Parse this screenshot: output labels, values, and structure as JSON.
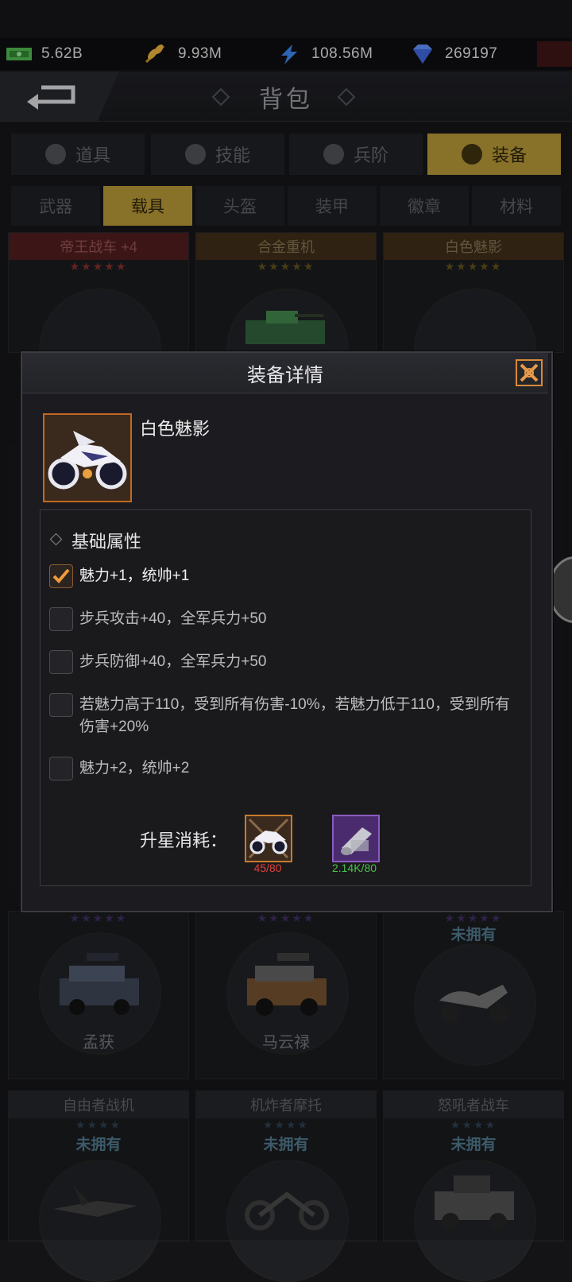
{
  "resources": [
    {
      "icon": "cash-icon",
      "value": "5.62B"
    },
    {
      "icon": "wheat-icon",
      "value": "9.93M"
    },
    {
      "icon": "lightning-icon",
      "value": "108.56M"
    },
    {
      "icon": "diamond-icon",
      "value": "269197"
    }
  ],
  "header": {
    "title": "背包"
  },
  "main_tabs": [
    {
      "label": "道具",
      "active": false
    },
    {
      "label": "技能",
      "active": false
    },
    {
      "label": "兵阶",
      "active": false
    },
    {
      "label": "装备",
      "active": true
    }
  ],
  "sub_tabs": [
    {
      "label": "武器",
      "active": false
    },
    {
      "label": "载具",
      "active": true
    },
    {
      "label": "头盔",
      "active": false
    },
    {
      "label": "装甲",
      "active": false
    },
    {
      "label": "徽章",
      "active": false
    },
    {
      "label": "材料",
      "active": false
    }
  ],
  "cards_top": [
    {
      "name": "帝王战车 +4",
      "stars": 3,
      "max_stars": 5
    },
    {
      "name": "合金重机",
      "stars": 1,
      "max_stars": 5
    },
    {
      "name": "白色魅影",
      "stars": 1,
      "max_stars": 5
    }
  ],
  "cards_mid": [
    {
      "owner": "孟获",
      "status": ""
    },
    {
      "owner": "马云禄",
      "status": ""
    },
    {
      "owner": "",
      "status": "未拥有"
    }
  ],
  "cards_bottom": [
    {
      "name": "自由者战机",
      "status": "未拥有"
    },
    {
      "name": "机炸者摩托",
      "status": "未拥有"
    },
    {
      "name": "怒吼者战车",
      "status": "未拥有"
    }
  ],
  "modal": {
    "title": "装备详情",
    "item_name": "白色魅影",
    "section_title": "基础属性",
    "attributes": [
      {
        "text": "魅力+1，统帅+1",
        "checked": true
      },
      {
        "text": "步兵攻击+40，全军兵力+50",
        "checked": false
      },
      {
        "text": "步兵防御+40，全军兵力+50",
        "checked": false
      },
      {
        "text": "若魅力高于110，受到所有伤害-10%，若魅力低于110，受到所有伤害+20%",
        "checked": false
      },
      {
        "text": "魅力+2，统帅+2",
        "checked": false
      }
    ],
    "cost_label": "升星消耗：",
    "costs": [
      {
        "icon": "motorcycle-icon",
        "count": "45/80",
        "color": "#e0423a"
      },
      {
        "icon": "steel-roll-icon",
        "count": "2.14K/80",
        "color": "#4cc24c"
      }
    ]
  },
  "colors": {
    "accent": "#a68a32",
    "rarity_orange": "#c06a22",
    "rarity_purple": "#8a5cc0"
  }
}
